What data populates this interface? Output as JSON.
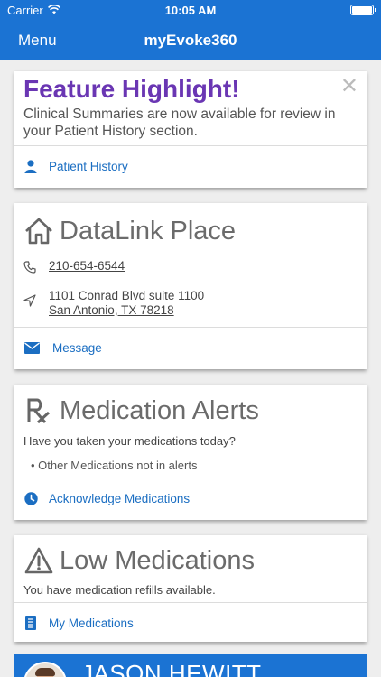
{
  "status_bar": {
    "carrier": "Carrier",
    "time": "10:05 AM"
  },
  "nav": {
    "menu_label": "Menu",
    "title": "myEvoke360"
  },
  "feature_card": {
    "headline": "Feature Highlight!",
    "body": "Clinical Summaries are now available for review in your Patient History section.",
    "close_glyph": "✕",
    "link_label": "Patient History"
  },
  "contact_card": {
    "name": "DataLink Place",
    "phone": "210-654-6544",
    "address_line1": "1101 Conrad Blvd suite 1100",
    "address_line2": "San Antonio, TX 78218",
    "message_label": "Message"
  },
  "alerts_card": {
    "title": "Medication Alerts",
    "question": "Have you taken your medications today?",
    "bullet": "• Other Medications not in alerts",
    "action_label": "Acknowledge Medications"
  },
  "low_card": {
    "title": "Low Medications",
    "text": "You have medication refills available.",
    "link_label": "My Medications"
  },
  "profile": {
    "name": "JASON HEWITT"
  },
  "colors": {
    "brand_blue": "#1b73d3",
    "link_blue": "#1b6ec2",
    "highlight_purple": "#6a36b3"
  },
  "icons": [
    "wifi-icon",
    "battery-icon",
    "close-icon",
    "person-icon",
    "home-icon",
    "phone-icon",
    "location-arrow-icon",
    "envelope-icon",
    "rx-icon",
    "clock-icon",
    "warning-icon",
    "medication-list-icon",
    "avatar"
  ]
}
